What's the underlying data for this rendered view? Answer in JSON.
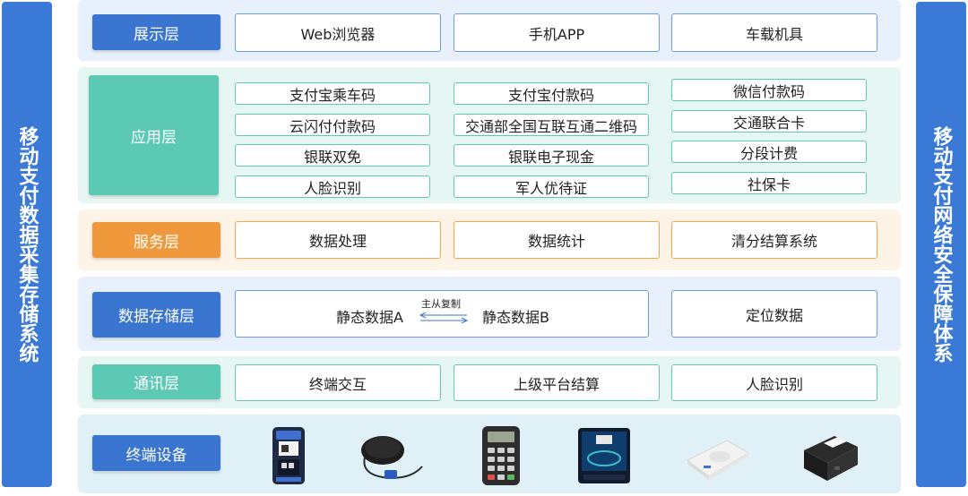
{
  "left_title": "移动支付数据采集存储系统",
  "right_title": "移动支付网络安全保障体系",
  "layers": {
    "display": {
      "title": "展示层",
      "items": [
        "Web浏览器",
        "手机APP",
        "车载机具"
      ]
    },
    "application": {
      "title": "应用层",
      "col1": [
        "支付宝乘车码",
        "云闪付付款码",
        "银联双免",
        "人脸识别"
      ],
      "col2": [
        "支付宝付款码",
        "交通部全国互联互通二维码",
        "银联电子现金",
        "军人优待证"
      ],
      "col3": [
        "微信付款码",
        "交通联合卡",
        "分段计费",
        "社保卡"
      ]
    },
    "service": {
      "title": "服务层",
      "items": [
        "数据处理",
        "数据统计",
        "清分结算系统"
      ]
    },
    "storage": {
      "title": "数据存储层",
      "static_a": "静态数据A",
      "replication": "主从复制",
      "static_b": "静态数据B",
      "location": "定位数据"
    },
    "comm": {
      "title": "通讯层",
      "items": [
        "终端交互",
        "上级平台结算",
        "人脸识别"
      ]
    },
    "terminal": {
      "title": "终端设备",
      "devices": [
        "pos-terminal-icon",
        "card-reader-puck-icon",
        "pin-pad-icon",
        "face-terminal-icon",
        "white-reader-icon",
        "receipt-printer-icon"
      ]
    }
  },
  "colors": {
    "side_blue": "#3a7ad6",
    "title_blue": "#3a75cf",
    "title_teal": "#5cc9b5",
    "title_orange": "#f0993c"
  }
}
